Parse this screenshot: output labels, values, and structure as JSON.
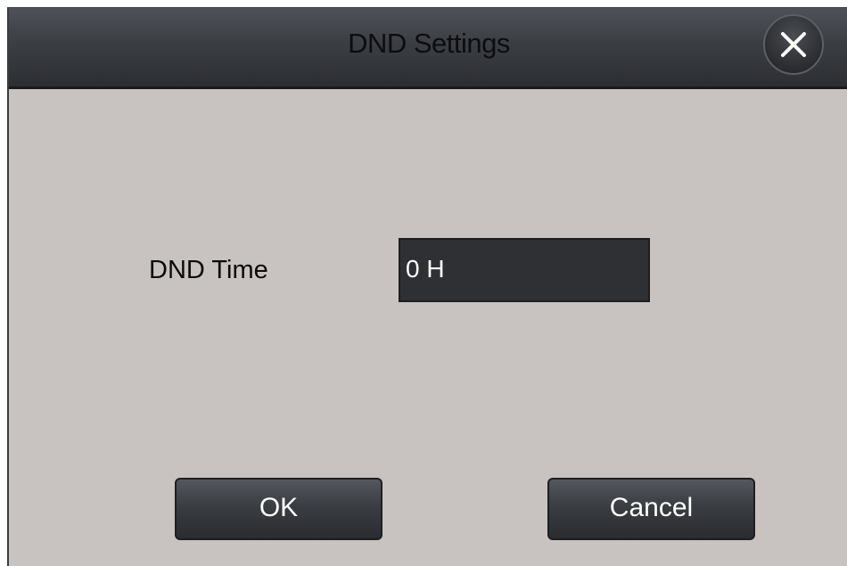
{
  "dialog": {
    "title": "DND Settings",
    "close_icon": "close-icon"
  },
  "form": {
    "dnd_time_label": "DND Time",
    "dnd_time_value": "0 H"
  },
  "buttons": {
    "ok_label": "OK",
    "cancel_label": "Cancel"
  }
}
